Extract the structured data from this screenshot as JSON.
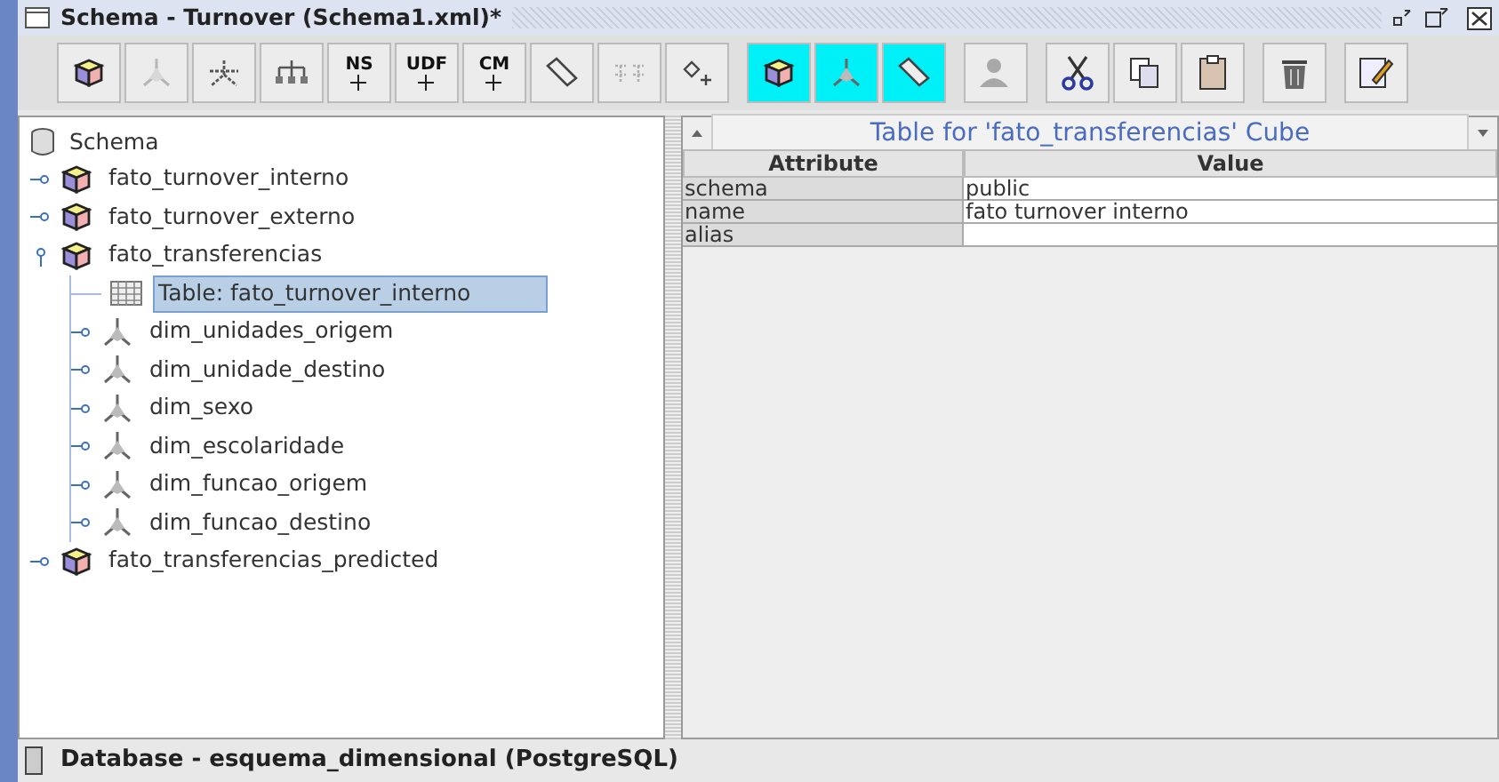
{
  "window": {
    "title": "Schema - Turnover (Schema1.xml)*"
  },
  "toolbar": [
    {
      "kind": "cube",
      "selected": false,
      "disabled": false
    },
    {
      "kind": "dimension",
      "selected": false,
      "disabled": true
    },
    {
      "kind": "dimension-multi",
      "selected": false,
      "disabled": false
    },
    {
      "kind": "hierarchy",
      "selected": false,
      "disabled": false
    },
    {
      "kind": "text",
      "label": "NS",
      "selected": false,
      "disabled": false
    },
    {
      "kind": "text",
      "label": "UDF",
      "selected": false,
      "disabled": false
    },
    {
      "kind": "text",
      "label": "CM",
      "selected": false,
      "disabled": false
    },
    {
      "kind": "measure",
      "selected": false,
      "disabled": false
    },
    {
      "kind": "levels",
      "selected": false,
      "disabled": true
    },
    {
      "kind": "property",
      "selected": false,
      "disabled": false
    },
    {
      "kind": "cube",
      "selected": true,
      "disabled": false
    },
    {
      "kind": "dimension",
      "selected": true,
      "disabled": false
    },
    {
      "kind": "measure",
      "selected": true,
      "disabled": false
    },
    {
      "kind": "user",
      "selected": false,
      "disabled": true
    },
    {
      "kind": "cut",
      "selected": false,
      "disabled": false
    },
    {
      "kind": "copy",
      "selected": false,
      "disabled": false
    },
    {
      "kind": "paste",
      "selected": false,
      "disabled": false
    },
    {
      "kind": "delete",
      "selected": false,
      "disabled": false
    },
    {
      "kind": "edit",
      "selected": false,
      "disabled": false
    }
  ],
  "tree": {
    "root": "Schema",
    "children": [
      {
        "kind": "cube",
        "label": "fato_turnover_interno",
        "expanded": false,
        "selected": false
      },
      {
        "kind": "cube",
        "label": "fato_turnover_externo",
        "expanded": false,
        "selected": false
      },
      {
        "kind": "cube",
        "label": "fato_transferencias",
        "expanded": true,
        "selected": false,
        "children": [
          {
            "kind": "table",
            "label": "Table: fato_turnover_interno",
            "selected": true
          },
          {
            "kind": "dimension",
            "label": "dim_unidades_origem",
            "expanded": false,
            "selected": false
          },
          {
            "kind": "dimension",
            "label": "dim_unidade_destino",
            "expanded": false,
            "selected": false
          },
          {
            "kind": "dimension",
            "label": "dim_sexo",
            "expanded": false,
            "selected": false
          },
          {
            "kind": "dimension",
            "label": "dim_escolaridade",
            "expanded": false,
            "selected": false
          },
          {
            "kind": "dimension",
            "label": "dim_funcao_origem",
            "expanded": false,
            "selected": false
          },
          {
            "kind": "dimension",
            "label": "dim_funcao_destino",
            "expanded": false,
            "selected": false
          }
        ]
      },
      {
        "kind": "cube",
        "label": "fato_transferencias_predicted",
        "expanded": false,
        "selected": false
      }
    ]
  },
  "panel": {
    "title": "Table for 'fato_transferencias' Cube",
    "columns": [
      "Attribute",
      "Value"
    ],
    "rows": [
      {
        "attribute": "schema",
        "value": "public"
      },
      {
        "attribute": "name",
        "value": "fato turnover interno"
      },
      {
        "attribute": "alias",
        "value": ""
      }
    ]
  },
  "status_bar": "Database - esquema_dimensional (PostgreSQL)"
}
